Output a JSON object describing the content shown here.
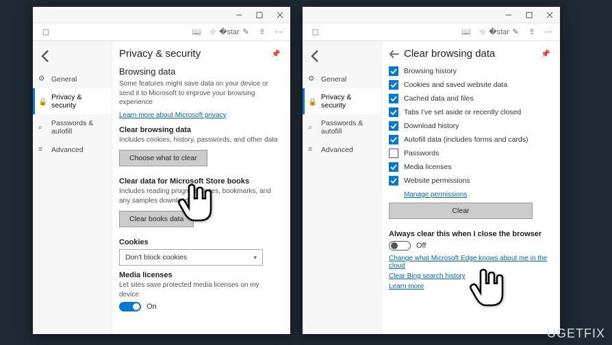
{
  "sidebar": {
    "items": [
      {
        "label": "General"
      },
      {
        "label": "Privacy & security"
      },
      {
        "label": "Passwords & autofill"
      },
      {
        "label": "Advanced"
      }
    ]
  },
  "left": {
    "title": "Privacy & security",
    "section1_h": "Browsing data",
    "section1_desc": "Some features might save data on your device or send it to Microsoft to improve your browsing experience",
    "section1_link": "Learn more about Microsoft privacy",
    "cbd_h": "Clear browsing data",
    "cbd_desc": "Includes cookies, history, passwords, and other data",
    "cbd_btn": "Choose what to clear",
    "books_h": "Clear data for Microsoft Store books",
    "books_desc": "Includes reading progress, notes, bookmarks, and any samples downloaded",
    "books_btn": "Clear books data",
    "cookies_h": "Cookies",
    "cookies_val": "Don't block cookies",
    "media_h": "Media licenses",
    "media_desc": "Let sites save protected media licenses on my device",
    "media_state": "On"
  },
  "right": {
    "title": "Clear browsing data",
    "items": [
      {
        "label": "Browsing history",
        "checked": true
      },
      {
        "label": "Cookies and saved website data",
        "checked": true
      },
      {
        "label": "Cached data and files",
        "checked": true
      },
      {
        "label": "Tabs I've set aside or recently closed",
        "checked": true
      },
      {
        "label": "Download history",
        "checked": true
      },
      {
        "label": "Autofill data (includes forms and cards)",
        "checked": true
      },
      {
        "label": "Passwords",
        "checked": false
      },
      {
        "label": "Media licenses",
        "checked": true
      },
      {
        "label": "Website permissions",
        "checked": true
      }
    ],
    "manage_link": "Manage permissions",
    "clear_btn": "Clear",
    "always_h": "Always clear this when I close the browser",
    "always_state": "Off",
    "link1": "Change what Microsoft Edge knows about me in the cloud",
    "link2": "Clear Bing search history",
    "link3": "Learn more"
  },
  "watermark": "UGETFIX"
}
